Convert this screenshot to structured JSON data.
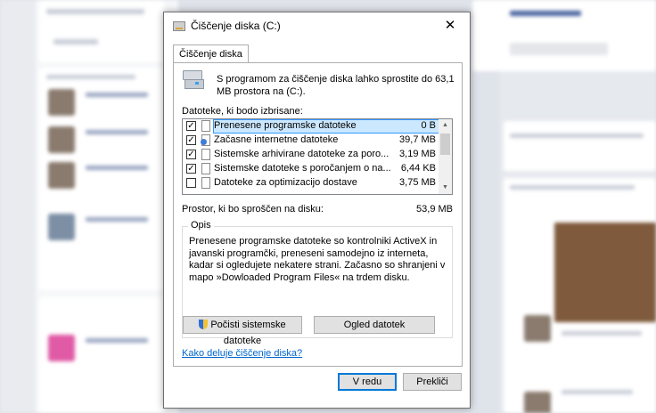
{
  "dialog": {
    "title": "Čiščenje diska  (C:)",
    "close_glyph": "✕",
    "tab_label": "Čiščenje diska",
    "header_text": "S programom za čiščenje diska lahko sprostite do 63,1 MB prostora na  (C:).",
    "files_label": "Datoteke, ki bodo izbrisane:",
    "files": [
      {
        "name": "Prenesene programske datoteke",
        "size": "0 B",
        "checked": true,
        "selected": true,
        "icon": "file-icon"
      },
      {
        "name": "Začasne internetne datoteke",
        "size": "39,7 MB",
        "checked": true,
        "selected": false,
        "icon": "web-file-icon"
      },
      {
        "name": "Sistemske arhivirane datoteke za poro...",
        "size": "3,19 MB",
        "checked": true,
        "selected": false,
        "icon": "file-icon"
      },
      {
        "name": "Sistemske datoteke s poročanjem o na...",
        "size": "6,44 KB",
        "checked": true,
        "selected": false,
        "icon": "file-icon"
      },
      {
        "name": "Datoteke za optimizacijo dostave",
        "size": "3,75 MB",
        "checked": false,
        "selected": false,
        "icon": "file-icon"
      }
    ],
    "space_label": "Prostor, ki bo sproščen na disku:",
    "space_value": "53,9 MB",
    "description_legend": "Opis",
    "description_text": "Prenesene programske datoteke so kontrolniki ActiveX in javanski programčki, preneseni samodejno iz interneta, kadar si ogledujete nekatere strani. Začasno so shranjeni v mapo »Dowloaded Program Files« na trdem disku.",
    "btn_system_label": "Počisti sistemske datoteke",
    "btn_view_label": "Ogled datotek",
    "help_link": "Kako deluje čiščenje diska?",
    "btn_ok_label": "V redu",
    "btn_cancel_label": "Prekliči"
  }
}
